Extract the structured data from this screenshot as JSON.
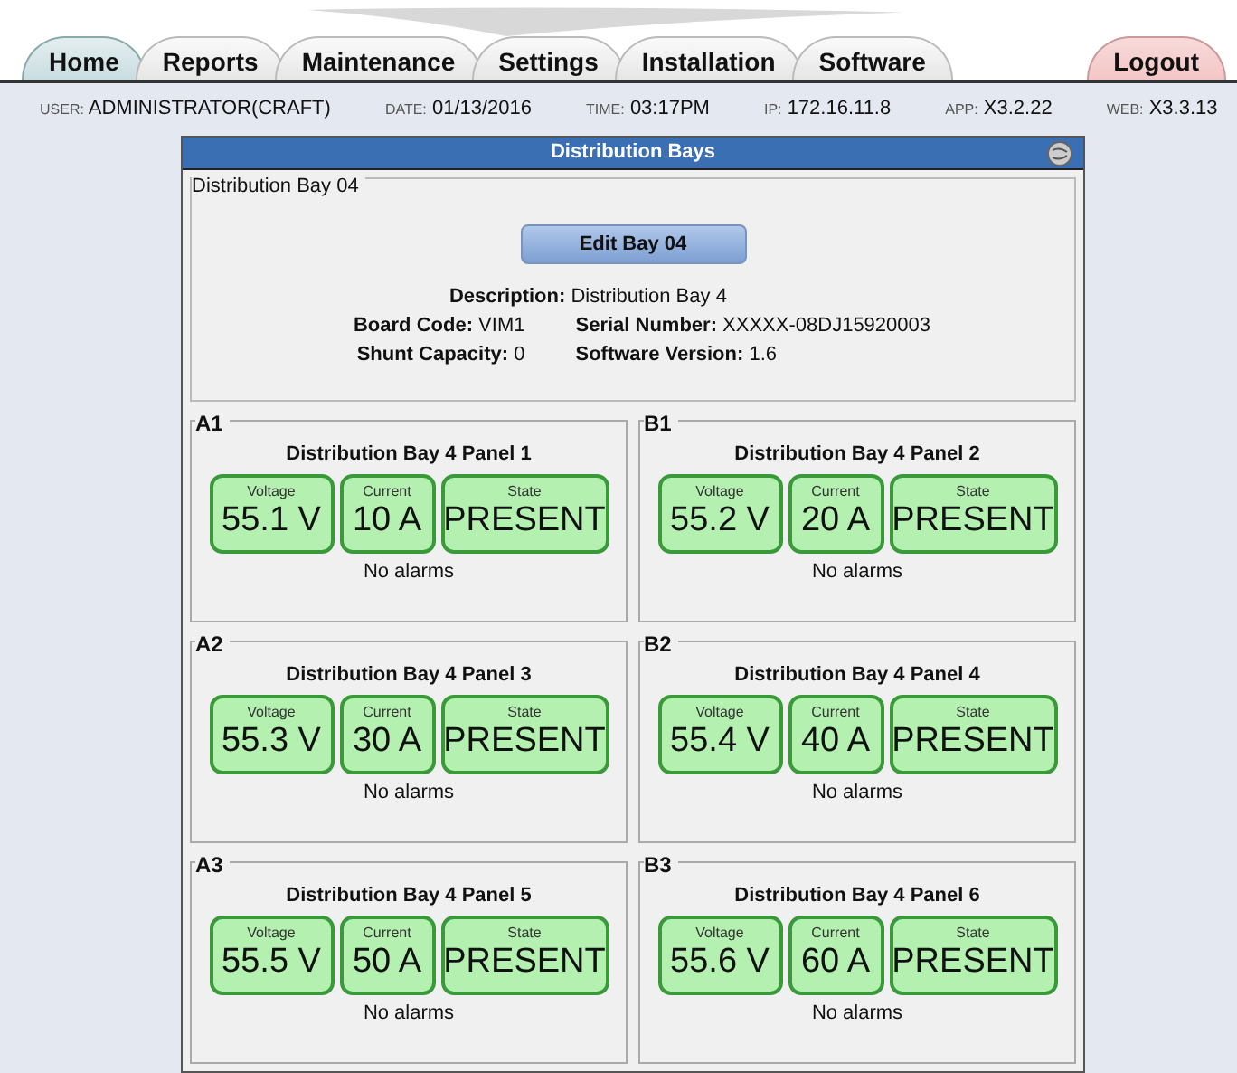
{
  "tabs": [
    {
      "label": "Home",
      "selected": true,
      "kind": "nav"
    },
    {
      "label": "Reports",
      "selected": false,
      "kind": "nav"
    },
    {
      "label": "Maintenance",
      "selected": false,
      "kind": "nav"
    },
    {
      "label": "Settings",
      "selected": false,
      "kind": "nav"
    },
    {
      "label": "Installation",
      "selected": false,
      "kind": "nav"
    },
    {
      "label": "Software",
      "selected": false,
      "kind": "nav"
    },
    {
      "label": "Logout",
      "selected": false,
      "kind": "logout"
    }
  ],
  "info_bar": [
    {
      "label": "USER:",
      "value": "ADMINISTRATOR(CRAFT)"
    },
    {
      "label": "DATE:",
      "value": "01/13/2016"
    },
    {
      "label": "TIME:",
      "value": "03:17PM"
    },
    {
      "label": "IP:",
      "value": "172.16.11.8"
    },
    {
      "label": "APP:",
      "value": "X3.2.22"
    },
    {
      "label": "WEB:",
      "value": "X3.3.13"
    }
  ],
  "window": {
    "title": "Distribution Bays"
  },
  "bay": {
    "legend": "Distribution Bay 04",
    "edit_button": "Edit Bay 04",
    "description": {
      "label": "Description:",
      "value": "Distribution Bay 4"
    },
    "board_code": {
      "label": "Board Code:",
      "value": "VIM1"
    },
    "serial_number": {
      "label": "Serial Number:",
      "value": "XXXXX-08DJ15920003"
    },
    "shunt_capacity": {
      "label": "Shunt Capacity:",
      "value": "0"
    },
    "software_version": {
      "label": "Software Version:",
      "value": "1.6"
    }
  },
  "panels": [
    {
      "legend": "A1",
      "title": "Distribution Bay 4 Panel 1",
      "voltage": {
        "label": "Voltage",
        "value": "55.1 V"
      },
      "current": {
        "label": "Current",
        "value": "10 A"
      },
      "state": {
        "label": "State",
        "value": "PRESENT"
      },
      "alarms": "No alarms"
    },
    {
      "legend": "B1",
      "title": "Distribution Bay 4 Panel 2",
      "voltage": {
        "label": "Voltage",
        "value": "55.2 V"
      },
      "current": {
        "label": "Current",
        "value": "20 A"
      },
      "state": {
        "label": "State",
        "value": "PRESENT"
      },
      "alarms": "No alarms"
    },
    {
      "legend": "A2",
      "title": "Distribution Bay 4 Panel 3",
      "voltage": {
        "label": "Voltage",
        "value": "55.3 V"
      },
      "current": {
        "label": "Current",
        "value": "30 A"
      },
      "state": {
        "label": "State",
        "value": "PRESENT"
      },
      "alarms": "No alarms"
    },
    {
      "legend": "B2",
      "title": "Distribution Bay 4 Panel 4",
      "voltage": {
        "label": "Voltage",
        "value": "55.4 V"
      },
      "current": {
        "label": "Current",
        "value": "40 A"
      },
      "state": {
        "label": "State",
        "value": "PRESENT"
      },
      "alarms": "No alarms"
    },
    {
      "legend": "A3",
      "title": "Distribution Bay 4 Panel 5",
      "voltage": {
        "label": "Voltage",
        "value": "55.5 V"
      },
      "current": {
        "label": "Current",
        "value": "50 A"
      },
      "state": {
        "label": "State",
        "value": "PRESENT"
      },
      "alarms": "No alarms"
    },
    {
      "legend": "B3",
      "title": "Distribution Bay 4 Panel 6",
      "voltage": {
        "label": "Voltage",
        "value": "55.6 V"
      },
      "current": {
        "label": "Current",
        "value": "60 A"
      },
      "state": {
        "label": "State",
        "value": "PRESENT"
      },
      "alarms": "No alarms"
    }
  ]
}
